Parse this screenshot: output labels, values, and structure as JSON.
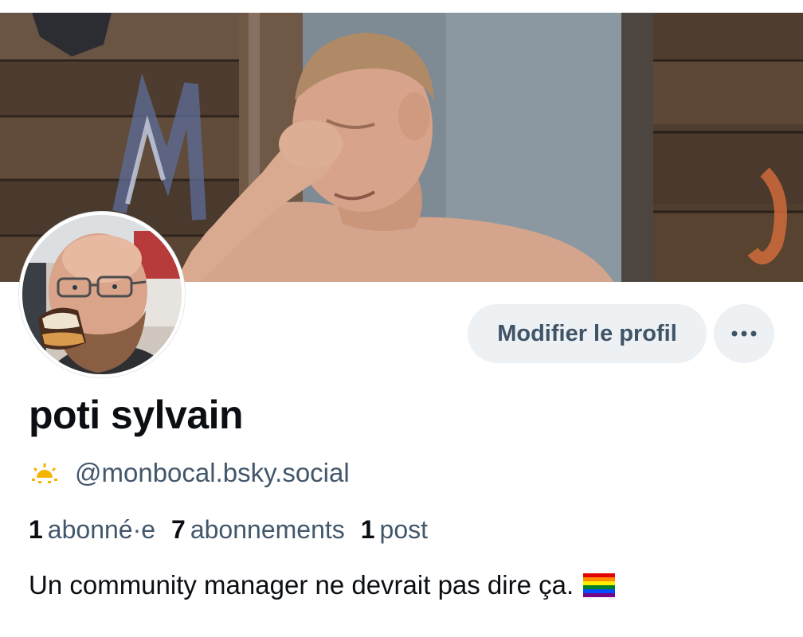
{
  "profile": {
    "display_name": "poti sylvain",
    "handle": "@monbocal.bsky.social",
    "bio": "Un community manager ne devrait pas dire ça.",
    "bio_emoji": "rainbow-flag-icon",
    "handle_emoji": "sunrise-icon"
  },
  "actions": {
    "edit_label": "Modifier le profil",
    "more_label": "···"
  },
  "stats": [
    {
      "count": "1",
      "label": "abonné·e"
    },
    {
      "count": "7",
      "label": "abonnements"
    },
    {
      "count": "1",
      "label": "post"
    }
  ],
  "colors": {
    "button_bg": "#eef1f4",
    "secondary_text": "#42576c",
    "primary_text": "#0b0f14"
  }
}
